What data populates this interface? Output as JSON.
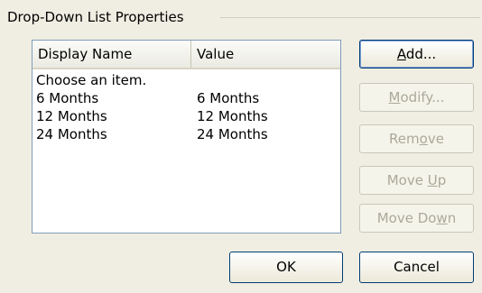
{
  "group": {
    "title": "Drop-Down List Properties"
  },
  "list": {
    "columns": [
      "Display Name",
      "Value"
    ],
    "rows": [
      {
        "display": "Choose an item.",
        "value": ""
      },
      {
        "display": "6 Months",
        "value": "6 Months"
      },
      {
        "display": "12 Months",
        "value": "12 Months"
      },
      {
        "display": "24 Months",
        "value": "24 Months"
      }
    ]
  },
  "buttons": {
    "add": {
      "pre": "",
      "mnemonic": "A",
      "post": "dd..."
    },
    "modify": {
      "pre": "",
      "mnemonic": "M",
      "post": "odify..."
    },
    "remove": {
      "pre": "Rem",
      "mnemonic": "o",
      "post": "ve"
    },
    "move_up": {
      "pre": "Move ",
      "mnemonic": "U",
      "post": "p"
    },
    "move_down": {
      "pre": "Move Do",
      "mnemonic": "w",
      "post": "n"
    },
    "ok": "OK",
    "cancel": "Cancel"
  }
}
